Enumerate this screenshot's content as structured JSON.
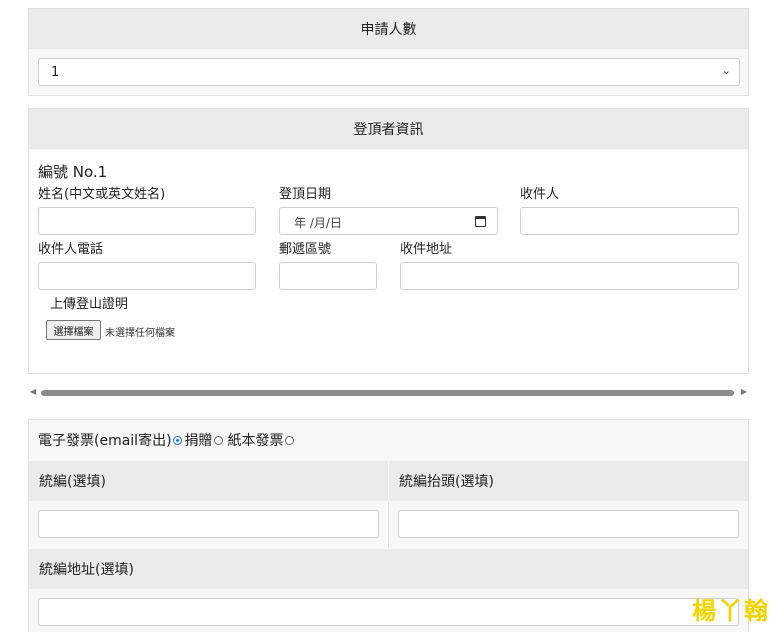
{
  "count_section": {
    "title": "申請人數",
    "selected": "1",
    "chevron": "chevron-down-icon"
  },
  "applicant_section": {
    "title": "登頂者資訊",
    "number": "編號 No.1",
    "name_label": "姓名(中文或英文姓名)",
    "date_label": "登頂日期",
    "date_placeholder": "年 /月/日",
    "recipient_label": "收件人",
    "phone_label": "收件人電話",
    "zip_label": "郵遞區號",
    "address_label": "收件地址",
    "upload_label": "上傳登山證明",
    "file_button": "選擇檔案",
    "file_status": "未選擇任何檔案"
  },
  "invoice_section": {
    "label_einvoice": "電子發票(email寄出)",
    "label_donate": "捐贈",
    "label_paper": "紙本發票",
    "selected": "電子發票(email寄出)",
    "tax_id_label": "統編(選填)",
    "tax_title_label": "統編抬頭(選填)",
    "tax_address_label": "統編地址(選填)"
  },
  "watermark": "楊丫翰",
  "colors": {
    "header_bg": "#ebebeb",
    "panel_bg": "#f7f7f7",
    "radio_accent": "#1a73e8",
    "watermark": "#f2d400"
  }
}
